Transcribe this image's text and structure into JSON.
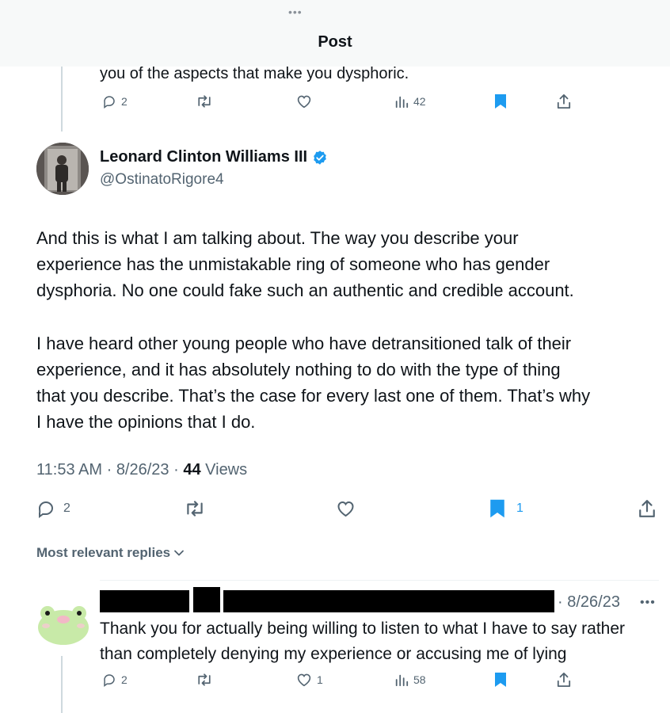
{
  "header": {
    "title": "Post",
    "more_dots": "•••"
  },
  "previous_post": {
    "text_tail": "you of the aspects that make you dysphoric.",
    "actions": {
      "replies": "2",
      "views": "42"
    }
  },
  "main_post": {
    "author_name": "Leonard Clinton Williams III",
    "author_handle": "@OstinatoRigore4",
    "verified": true,
    "paragraph1_lines": [
      "And this is what I am talking about. The way you describe your",
      "experience has the unmistakable ring of someone who has gender",
      "dysphoria. No one could fake such an authentic and credible account."
    ],
    "paragraph2_lines": [
      "I have heard other young people who have detransitioned talk of their",
      "experience, and it has absolutely nothing to do with the type of thing",
      "that you describe. That’s the case for every last one of them. That’s why",
      "I have the opinions that I do."
    ],
    "time": "11:53 AM",
    "date": "8/26/23",
    "views_count": "44",
    "views_label": "Views",
    "actions": {
      "replies": "2",
      "bookmarks": "1"
    }
  },
  "replies_sort": {
    "label": "Most relevant replies"
  },
  "reply": {
    "date": "8/26/23",
    "more": "•••",
    "text_lines": [
      "Thank you for actually being willing to listen to what I have to say rather",
      "than completely denying my experience or accusing me of lying"
    ],
    "actions": {
      "replies": "2",
      "likes": "1",
      "views": "58"
    }
  },
  "colors": {
    "accent": "#1d9bf0",
    "secondary_text": "#536471",
    "primary_text": "#0f1419",
    "thread_line": "#cfd9de"
  }
}
